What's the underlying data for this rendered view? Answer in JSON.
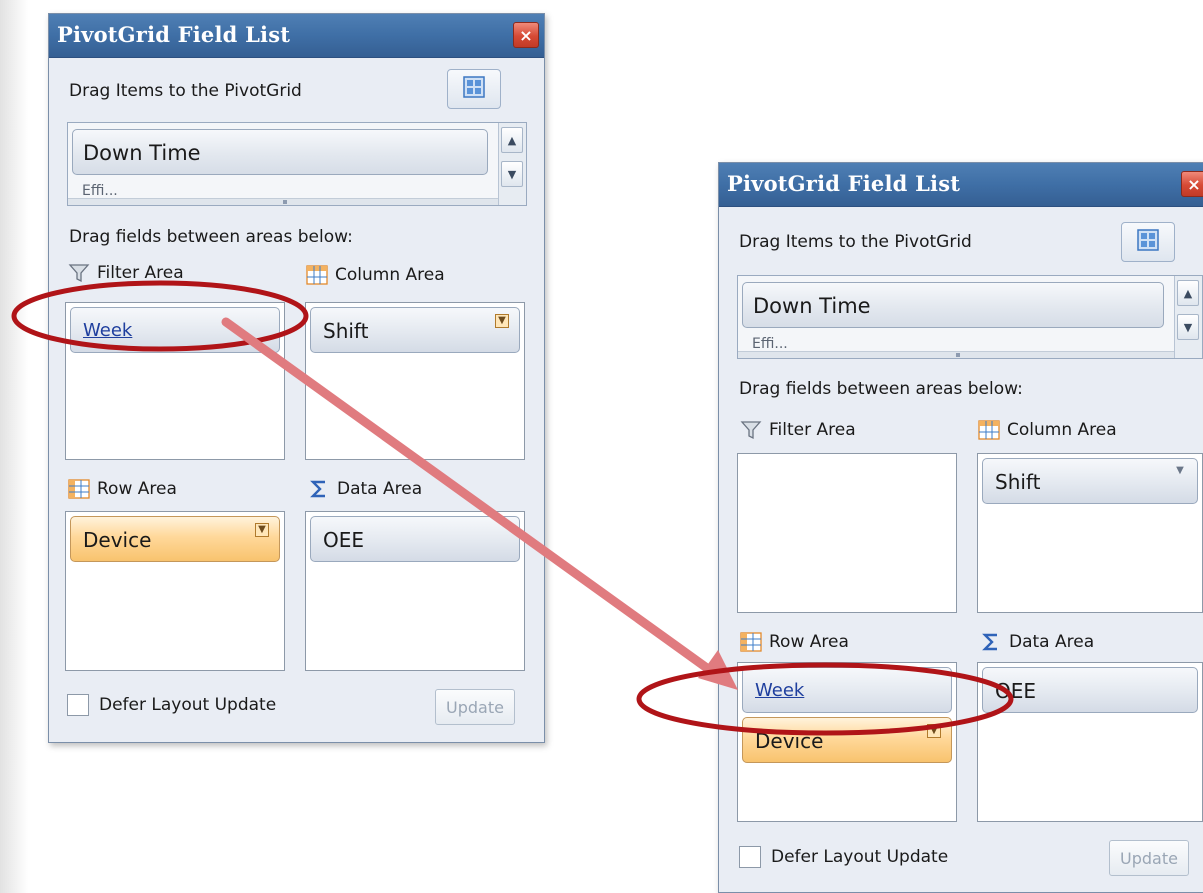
{
  "panels": [
    {
      "title": "PivotGrid Field List",
      "close_icon": "×",
      "drag_items_label": "Drag Items to the PivotGrid",
      "field_list": {
        "first_item": "Down Time",
        "peek_item": "Effi..."
      },
      "drag_fields_label": "Drag fields between areas below:",
      "filter_area": {
        "label": "Filter Area",
        "fields": [
          "Week"
        ]
      },
      "column_area": {
        "label": "Column Area",
        "fields": [
          "Shift"
        ]
      },
      "row_area": {
        "label": "Row Area",
        "fields": [
          "Device"
        ]
      },
      "data_area": {
        "label": "Data Area",
        "fields": [
          "OEE"
        ]
      },
      "defer_label": "Defer Layout Update",
      "update_label": "Update"
    },
    {
      "title": "PivotGrid Field List",
      "close_icon": "×",
      "drag_items_label": "Drag Items to the PivotGrid",
      "field_list": {
        "first_item": "Down Time",
        "peek_item": "Effi..."
      },
      "drag_fields_label": "Drag fields between areas below:",
      "filter_area": {
        "label": "Filter Area",
        "fields": []
      },
      "column_area": {
        "label": "Column Area",
        "fields": [
          "Shift"
        ]
      },
      "row_area": {
        "label": "Row Area",
        "fields": [
          "Week",
          "Device"
        ]
      },
      "data_area": {
        "label": "Data Area",
        "fields": [
          "OEE"
        ]
      },
      "defer_label": "Defer Layout Update",
      "update_label": "Update"
    }
  ],
  "icons": {
    "filter": "funnel-icon",
    "column": "column-grid-icon",
    "row": "row-grid-icon",
    "data": "sigma-icon",
    "layout": "layout-grid-icon",
    "scroll_up": "▲",
    "scroll_down": "▼",
    "dropdown": "▼"
  },
  "colors": {
    "title_bar": "#3f6fa6",
    "annotation_circle": "#b01418",
    "annotation_arrow": "#e07b7f",
    "orange_chip": "#f8c36e"
  }
}
